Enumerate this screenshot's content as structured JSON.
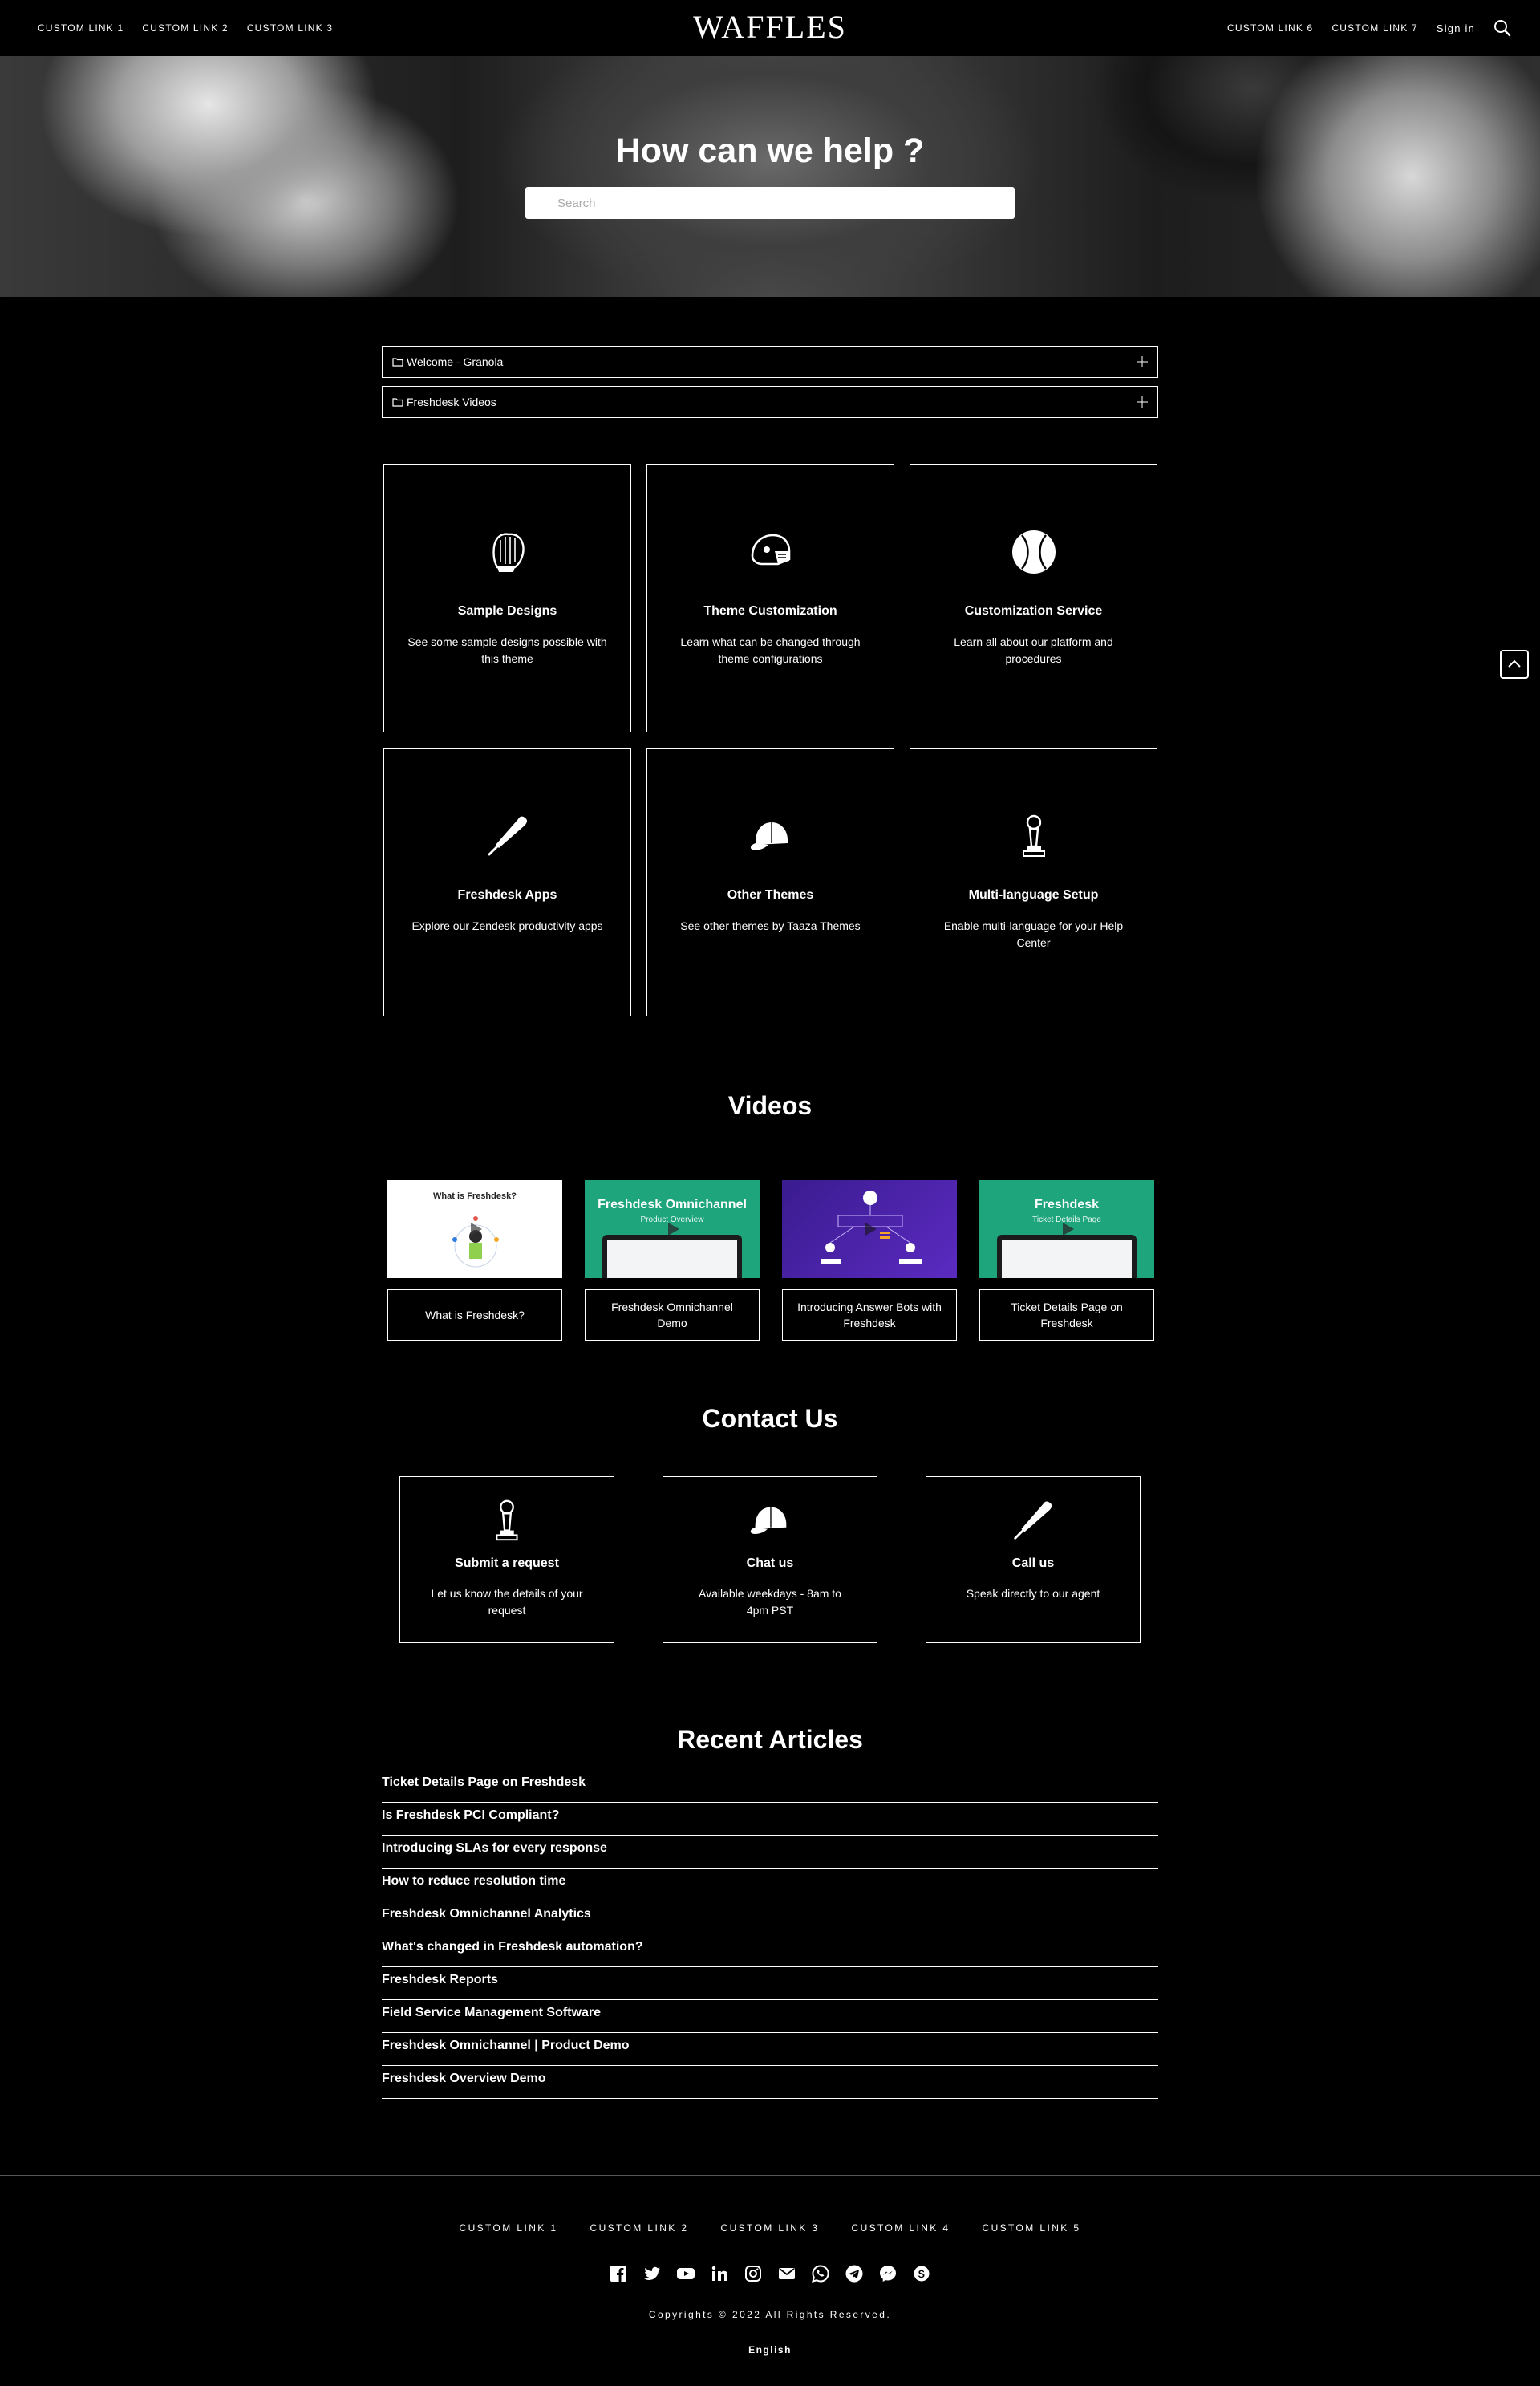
{
  "header": {
    "logo": "WAFFLES",
    "left_links": [
      "CUSTOM LINK 1",
      "CUSTOM LINK 2",
      "CUSTOM LINK 3"
    ],
    "right_links": [
      "CUSTOM LINK 6",
      "CUSTOM LINK 7"
    ],
    "signin_label": "Sign in",
    "search_icon": "search-icon"
  },
  "hero": {
    "title": "How can we help ?",
    "search_placeholder": "Search"
  },
  "folders": [
    {
      "label": "Welcome - Granola",
      "icon": "folder-icon"
    },
    {
      "label": "Freshdesk Videos",
      "icon": "folder-icon"
    }
  ],
  "categories": [
    {
      "title": "Sample Designs",
      "description": "See some sample designs possible with this theme",
      "icon": "baseball-glove-icon"
    },
    {
      "title": "Theme Customization",
      "description": "Learn what can be changed through theme configurations",
      "icon": "batting-helmet-icon"
    },
    {
      "title": "Customization Service",
      "description": "Learn all about our platform and procedures",
      "icon": "baseball-icon"
    },
    {
      "title": "Freshdesk Apps",
      "description": "Explore our Zendesk productivity apps",
      "icon": "baseball-bat-icon"
    },
    {
      "title": "Other Themes",
      "description": "See other themes by Taaza Themes",
      "icon": "baseball-cap-icon"
    },
    {
      "title": "Multi-language Setup",
      "description": "Enable multi-language for your Help Center",
      "icon": "trophy-icon"
    }
  ],
  "videos": {
    "title": "Videos",
    "items": [
      {
        "caption": "What is Freshdesk?",
        "thumb_title": "What is Freshdesk?",
        "thumb_subtitle": ""
      },
      {
        "caption": "Freshdesk Omnichannel Demo",
        "thumb_title": "Freshdesk Omnichannel",
        "thumb_subtitle": "Product Overview"
      },
      {
        "caption": "Introducing Answer Bots with Freshdesk",
        "thumb_title": "",
        "thumb_subtitle": ""
      },
      {
        "caption": "Ticket Details Page on Freshdesk",
        "thumb_title": "Freshdesk",
        "thumb_subtitle": "Ticket Details Page"
      }
    ]
  },
  "contact": {
    "title": "Contact Us",
    "items": [
      {
        "title": "Submit a request",
        "description": "Let us know the details of your request",
        "icon": "trophy-icon"
      },
      {
        "title": "Chat us",
        "description": "Available weekdays - 8am to 4pm PST",
        "icon": "baseball-cap-icon"
      },
      {
        "title": "Call us",
        "description": "Speak directly to our agent",
        "icon": "baseball-bat-icon"
      }
    ]
  },
  "recent_articles": {
    "title": "Recent Articles",
    "items": [
      "Ticket Details Page on Freshdesk",
      "Is Freshdesk PCI Compliant?",
      "Introducing SLAs for every response",
      "How to reduce resolution time",
      "Freshdesk Omnichannel Analytics",
      "What's changed in Freshdesk automation?",
      "Freshdesk Reports",
      "Field Service Management Software",
      "Freshdesk Omnichannel | Product Demo",
      "Freshdesk Overview Demo"
    ]
  },
  "footer": {
    "links": [
      "CUSTOM LINK 1",
      "CUSTOM LINK 2",
      "CUSTOM LINK 3",
      "CUSTOM LINK 4",
      "CUSTOM LINK 5"
    ],
    "social_icons": [
      "facebook-icon",
      "twitter-icon",
      "youtube-icon",
      "linkedin-icon",
      "instagram-icon",
      "email-icon",
      "whatsapp-icon",
      "telegram-icon",
      "messenger-icon",
      "skype-icon"
    ],
    "copyright": "Copyrights © 2022 All Rights Reserved.",
    "language": "English"
  },
  "colors": {
    "background": "#000000",
    "text": "#ffffff",
    "accent_green": "#1fa57c",
    "accent_purple": "#4a24a8"
  }
}
